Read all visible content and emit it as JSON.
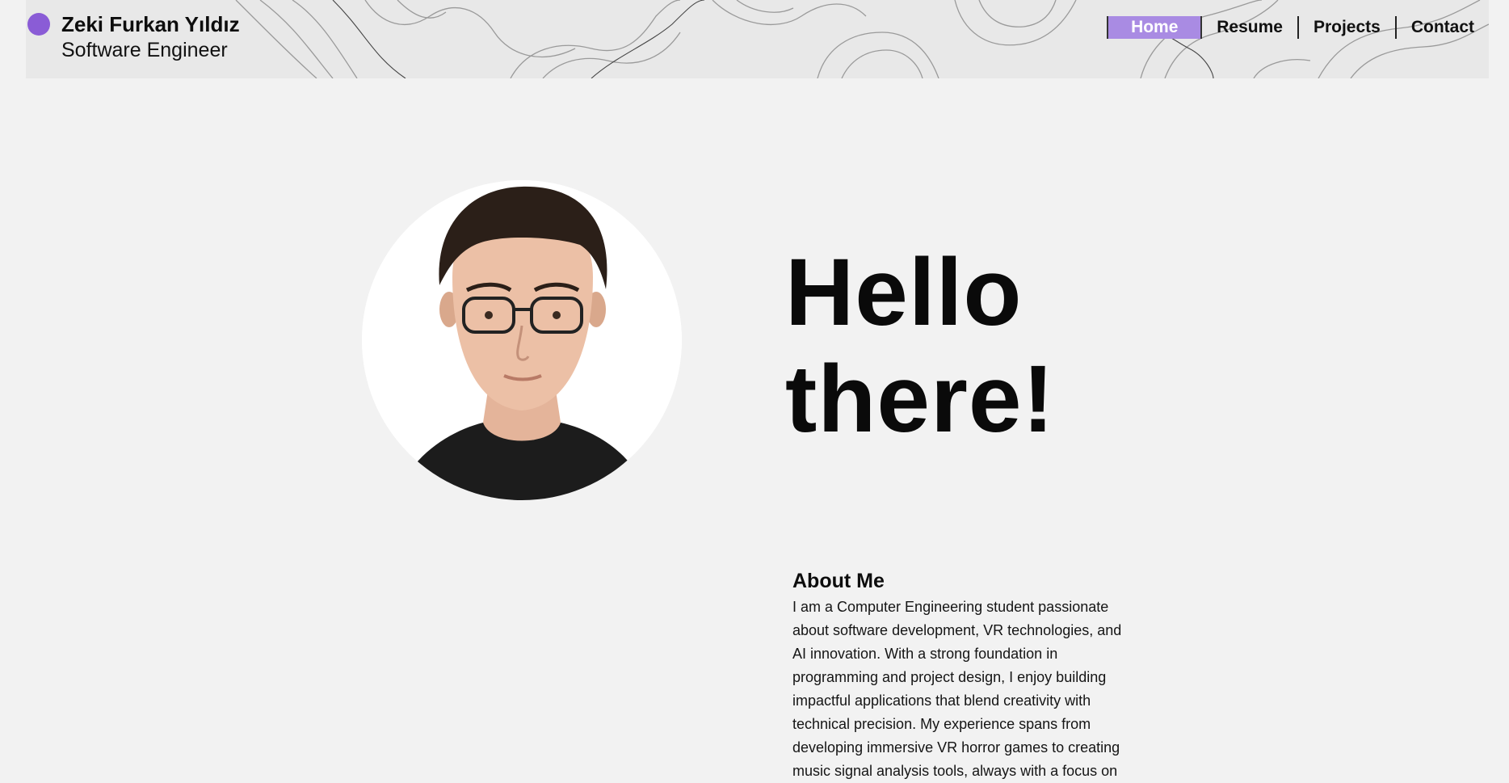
{
  "header": {
    "name": "Zeki Furkan Yıldız",
    "role": "Software Engineer",
    "accent_color": "#8a5cd6"
  },
  "nav": {
    "items": [
      {
        "label": "Home",
        "active": true
      },
      {
        "label": "Resume",
        "active": false
      },
      {
        "label": "Projects",
        "active": false
      },
      {
        "label": "Contact",
        "active": false
      }
    ],
    "active_color": "#a98be3"
  },
  "hero": {
    "title": "Hello there!"
  },
  "about": {
    "heading": "About Me",
    "body": "I am a Computer Engineering student passionate about software development, VR technologies, and AI innovation. With a strong foundation in programming and project design, I enjoy building impactful applications that blend creativity with technical precision. My experience spans from developing immersive VR horror games to creating music signal analysis tools, always with a focus on"
  }
}
